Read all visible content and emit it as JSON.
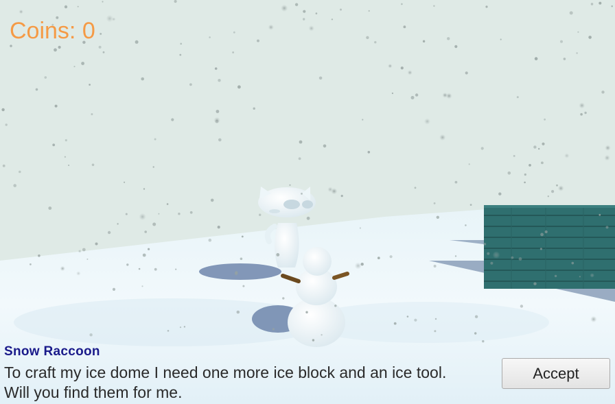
{
  "hud": {
    "coins_label": "Coins: 0"
  },
  "dialog": {
    "speaker": "Snow Raccoon",
    "lines": [
      "To craft my ice dome I need one more ice block and an ice tool.",
      "Will you find them for me."
    ],
    "accept_label": "Accept"
  },
  "colors": {
    "sky": "#dfeae6",
    "snow": "#eef7fb",
    "fence": "#2f6f6f",
    "coins_text": "#f59a45",
    "speaker_text": "#1a1a8a"
  }
}
